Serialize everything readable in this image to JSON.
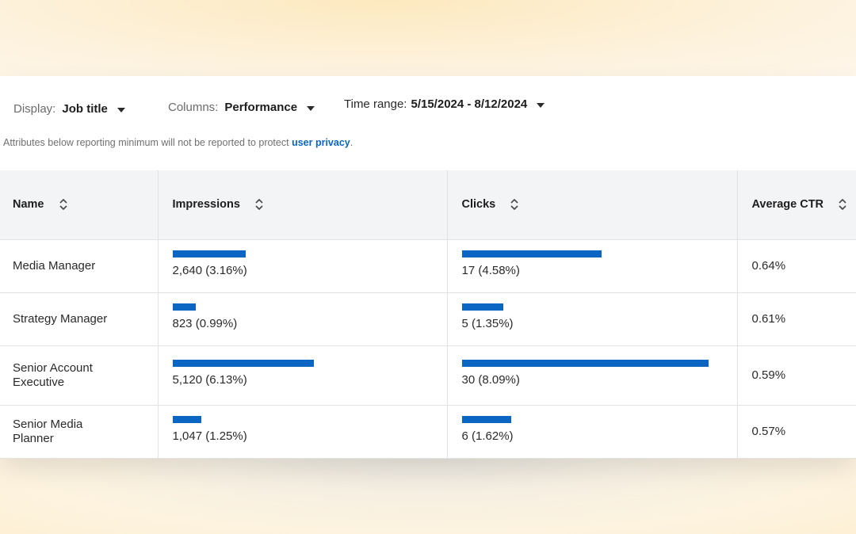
{
  "filters": {
    "display": {
      "label": "Display:",
      "value": "Job title"
    },
    "columns": {
      "label": "Columns:",
      "value": "Performance"
    },
    "time_range": {
      "label": "Time range:",
      "value": "5/15/2024 - 8/12/2024"
    }
  },
  "notice": {
    "text": "Attributes below reporting minimum will not be reported to protect ",
    "link": "user privacy",
    "end": "."
  },
  "table": {
    "headers": [
      "Name",
      "Impressions",
      "Clicks",
      "Average CTR"
    ],
    "rows": [
      {
        "name": "Media Manager",
        "impressions": "2,640 (3.16%)",
        "impressions_share": 3.16,
        "clicks": "17 (4.58%)",
        "clicks_share": 4.58,
        "ctr": "0.64%"
      },
      {
        "name": "Strategy Manager",
        "impressions": "823 (0.99%)",
        "impressions_share": 0.99,
        "clicks": "5 (1.35%)",
        "clicks_share": 1.35,
        "ctr": "0.61%"
      },
      {
        "name": "Senior Account Executive",
        "impressions": "5,120 (6.13%)",
        "impressions_share": 6.13,
        "clicks": "30 (8.09%)",
        "clicks_share": 8.09,
        "ctr": "0.59%"
      },
      {
        "name": "Senior Media Planner",
        "impressions": "1,047 (1.25%)",
        "impressions_share": 1.25,
        "clicks": "6 (1.62%)",
        "clicks_share": 1.62,
        "ctr": "0.57%"
      }
    ]
  },
  "colors": {
    "accent": "#0a66c2",
    "header_bg": "#f3f4f6"
  }
}
